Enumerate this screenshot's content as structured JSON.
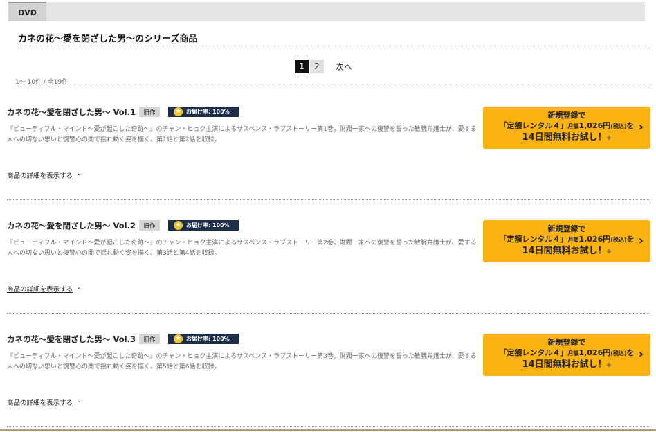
{
  "tab": {
    "label": "DVD"
  },
  "series_title": "カネの花〜愛を閉ざした男〜のシリーズ商品",
  "pagination": {
    "pages": [
      "1",
      "2"
    ],
    "current": "1",
    "next_label": "次へ"
  },
  "count_text": "1〜 10件 / 全19件",
  "items": [
    {
      "title": "カネの花〜愛を閉ざした男〜 Vol.1",
      "badge_old": "旧作",
      "delivery_text": "お届け率: 100%",
      "description": "『ビューティフル・マインド〜愛が起こした奇跡〜』のチャン・ヒョク主演によるサスペンス・ラブストーリー第1巻。財閥一家への復讐を誓った敏腕弁護士が、愛する人への切ない思いと復讐心の間で揺れ動く姿を描く。第1話と第2話を収録。",
      "detail_link": "商品の詳細を表示する"
    },
    {
      "title": "カネの花〜愛を閉ざした男〜 Vol.2",
      "badge_old": "旧作",
      "delivery_text": "お届け率: 100%",
      "description": "『ビューティフル・マインド〜愛が起こした奇跡〜』のチャン・ヒョク主演によるサスペンス・ラブストーリー第2巻。財閥一家への復讐を誓った敏腕弁護士が、愛する人への切ない思いと復讐心の間で揺れ動く姿を描く。第3話と第4話を収録。",
      "detail_link": "商品の詳細を表示する"
    },
    {
      "title": "カネの花〜愛を閉ざした男〜 Vol.3",
      "badge_old": "旧作",
      "delivery_text": "お届け率: 100%",
      "description": "『ビューティフル・マインド〜愛が起こした奇跡〜』のチャン・ヒョク主演によるサスペンス・ラブストーリー第3巻。財閥一家への復讐を誓った敏腕弁護士が、愛する人への切ない思いと復讐心の間で揺れ動く姿を描く。第5話と第6話を収録。",
      "detail_link": "商品の詳細を表示する"
    }
  ],
  "cta": {
    "line1": "新規登録で",
    "line2_main": "「定額レンタル４」",
    "line2_month": "月額",
    "line2_price": "1,026円",
    "line2_tax": "(税込)",
    "line2_suffix": "を",
    "line3": "14日間無料お試し！",
    "line3_note": "※"
  },
  "icons": {
    "delivery": "star-icon",
    "cta_arrow": "chevron-right-icon",
    "detail_arrow": "chevron-down-icon"
  },
  "colors": {
    "cta_bg": "#fbb313",
    "delivery_badge_bg": "#1c2e4a",
    "star": "#f3c32f"
  }
}
